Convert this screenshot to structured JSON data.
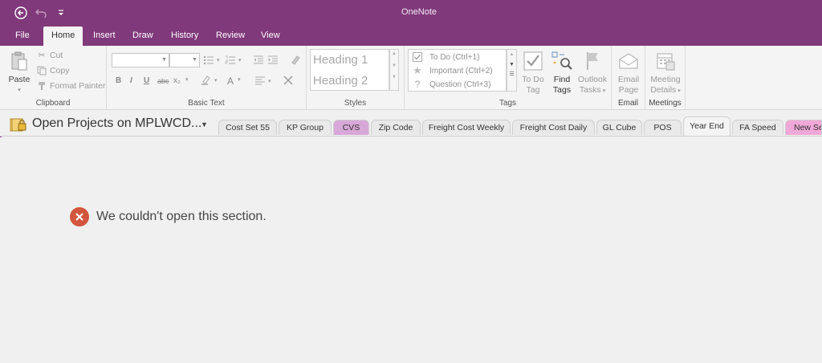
{
  "app": {
    "title": "OneNote"
  },
  "qat": {
    "back_icon": "back-arrow-icon",
    "undo_icon": "undo-icon",
    "more_icon": "customize-qat-icon"
  },
  "ribbon_tabs": [
    {
      "label": "File"
    },
    {
      "label": "Home",
      "active": true
    },
    {
      "label": "Insert"
    },
    {
      "label": "Draw"
    },
    {
      "label": "History"
    },
    {
      "label": "Review"
    },
    {
      "label": "View"
    }
  ],
  "clipboard": {
    "paste": "Paste",
    "cut": "Cut",
    "copy": "Copy",
    "format_painter": "Format Painter",
    "label": "Clipboard"
  },
  "basic_text": {
    "label": "Basic Text",
    "bold": "B",
    "italic": "I",
    "underline": "U",
    "strike": "abc",
    "subscript": "x₂",
    "font_color": "A"
  },
  "styles": {
    "heading1": "Heading 1",
    "heading2": "Heading 2",
    "label": "Styles"
  },
  "tags": {
    "items": [
      {
        "label": "To Do (Ctrl+1)",
        "icon": "checkbox-icon"
      },
      {
        "label": "Important (Ctrl+2)",
        "icon": "star-icon"
      },
      {
        "label": "Question (Ctrl+3)",
        "icon": "question-icon"
      }
    ],
    "todo_tag_l1": "To Do",
    "todo_tag_l2": "Tag",
    "find_tags_l1": "Find",
    "find_tags_l2": "Tags",
    "outlook_tasks_l1": "Outlook",
    "outlook_tasks_l2": "Tasks",
    "label": "Tags"
  },
  "email": {
    "l1": "Email",
    "l2": "Page",
    "label": "Email"
  },
  "meetings": {
    "l1": "Meeting",
    "l2": "Details",
    "label": "Meetings"
  },
  "notebook": {
    "name": "Open Projects on MPLWCD..."
  },
  "section_tabs": [
    {
      "label": "Cost Set 55"
    },
    {
      "label": "KP Group"
    },
    {
      "label": "CVS",
      "color": "#d8a8d8"
    },
    {
      "label": "Zip Code"
    },
    {
      "label": "Freight Cost Weekly"
    },
    {
      "label": "Freight Cost Daily"
    },
    {
      "label": "GL Cube"
    },
    {
      "label": "POS"
    },
    {
      "label": "Year End",
      "active": true
    },
    {
      "label": "FA Speed"
    },
    {
      "label": "New Se",
      "color": "#f0a8d8"
    }
  ],
  "colors": {
    "accent": "#80397b",
    "error": "#d2563c"
  },
  "content": {
    "error_message": "We couldn't open this section."
  }
}
